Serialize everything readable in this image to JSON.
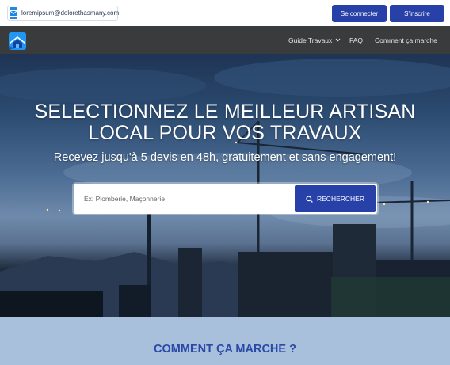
{
  "topbar": {
    "email": "loremipsum@dolorethasmany.com",
    "email_icon": "mail-icon",
    "login_label": "Se connecter",
    "signup_label": "S'inscrire"
  },
  "nav": {
    "logo_icon": "house-logo-icon",
    "items": [
      {
        "label": "Guide Travaux",
        "has_dropdown": true
      },
      {
        "label": "FAQ"
      },
      {
        "label": "Comment ça marche"
      }
    ]
  },
  "hero": {
    "title_line1": "SELECTIONNEZ LE MEILLEUR ARTISAN",
    "title_line2": "LOCAL POUR VOS TRAVAUX",
    "subtitle": "Recevez jusqu'à 5 devis en 48h, gratuitement et sans engagement!",
    "search": {
      "placeholder": "Ex: Plomberie, Maçonnerie",
      "value": "",
      "button_label": "RECHERCHER",
      "button_icon": "search-icon"
    }
  },
  "how_section": {
    "title": "COMMENT ÇA MARCHE ?"
  },
  "colors": {
    "primary": "#2741a9",
    "nav_bg": "#3a3b3d",
    "section_bg": "#a8c0dc",
    "section_title": "#2a4aa8"
  }
}
